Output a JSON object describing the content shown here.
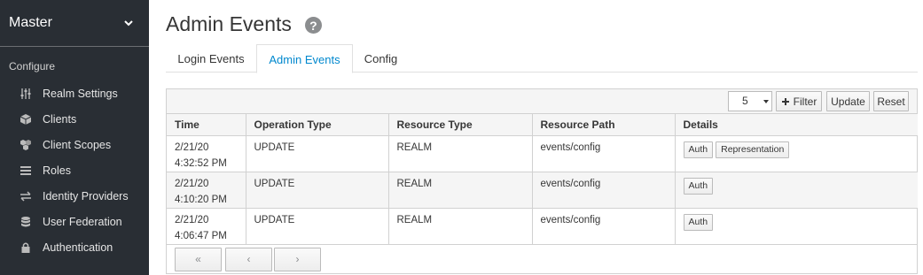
{
  "sidebar": {
    "realm": "Master",
    "section": "Configure",
    "items": [
      {
        "label": "Realm Settings",
        "icon": "sliders-icon"
      },
      {
        "label": "Clients",
        "icon": "cube-icon"
      },
      {
        "label": "Client Scopes",
        "icon": "cubes-icon"
      },
      {
        "label": "Roles",
        "icon": "list-icon"
      },
      {
        "label": "Identity Providers",
        "icon": "exchange-icon"
      },
      {
        "label": "User Federation",
        "icon": "database-icon"
      },
      {
        "label": "Authentication",
        "icon": "lock-icon"
      }
    ]
  },
  "page": {
    "title": "Admin Events",
    "help": "?"
  },
  "tabs": [
    {
      "label": "Login Events"
    },
    {
      "label": "Admin Events",
      "active": true
    },
    {
      "label": "Config"
    }
  ],
  "toolbar": {
    "page_size": "5",
    "filter": "Filter",
    "update": "Update",
    "reset": "Reset"
  },
  "table": {
    "headers": [
      "Time",
      "Operation Type",
      "Resource Type",
      "Resource Path",
      "Details"
    ],
    "rows": [
      {
        "date": "2/21/20",
        "time": "4:32:52 PM",
        "operation": "UPDATE",
        "resource_type": "REALM",
        "resource_path": "events/config",
        "details": [
          "Auth",
          "Representation"
        ]
      },
      {
        "date": "2/21/20",
        "time": "4:10:20 PM",
        "operation": "UPDATE",
        "resource_type": "REALM",
        "resource_path": "events/config",
        "details": [
          "Auth"
        ]
      },
      {
        "date": "2/21/20",
        "time": "4:06:47 PM",
        "operation": "UPDATE",
        "resource_type": "REALM",
        "resource_path": "events/config",
        "details": [
          "Auth"
        ]
      }
    ]
  },
  "pager": {
    "first": "«",
    "prev": "‹",
    "next": "›"
  },
  "colors": {
    "sidebar_bg": "#292e34",
    "accent": "#0088ce"
  }
}
